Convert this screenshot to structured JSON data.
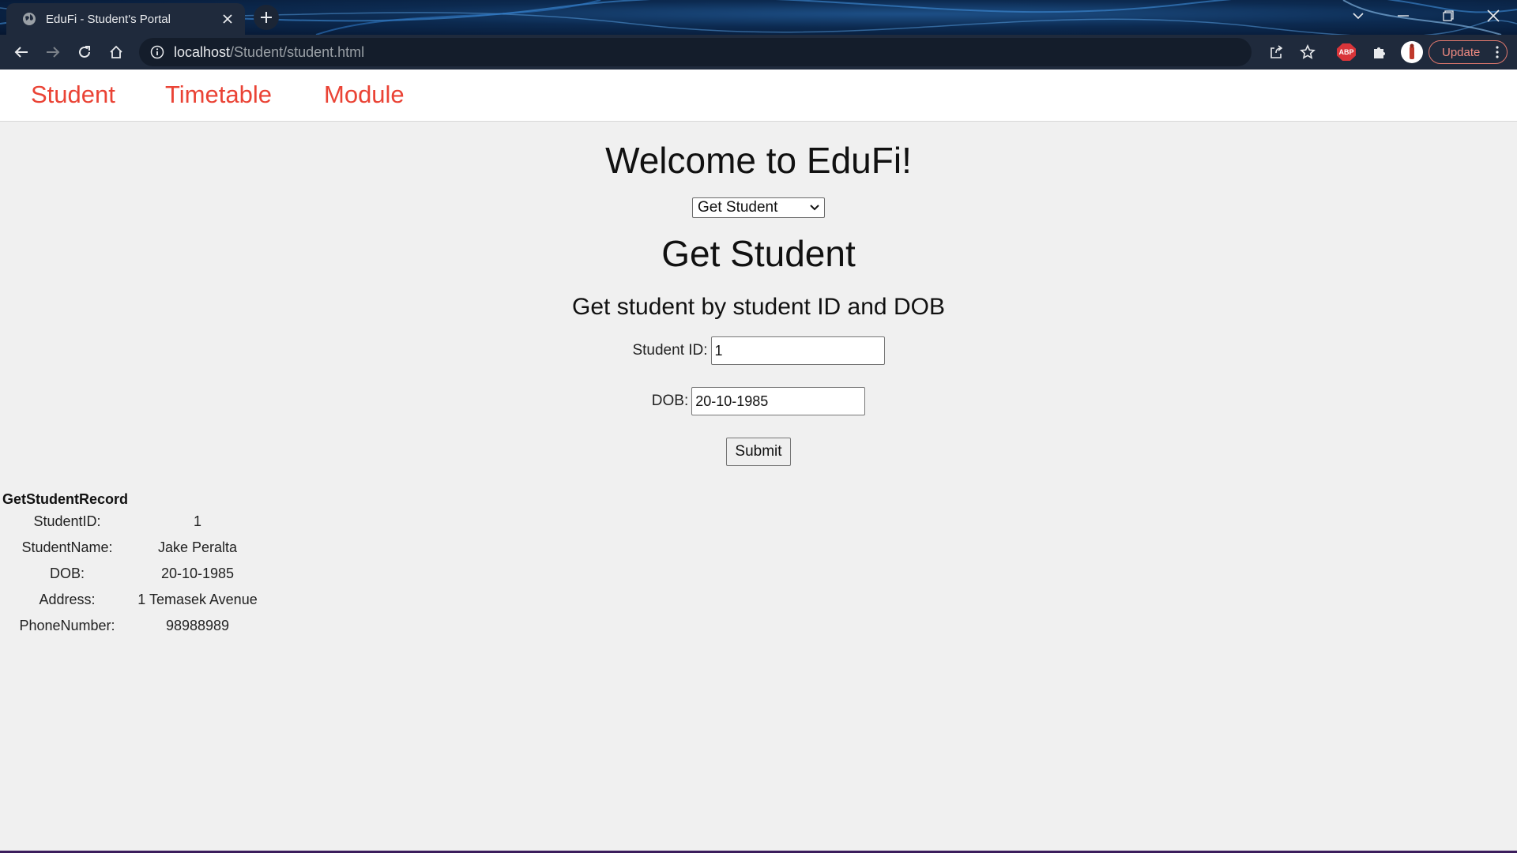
{
  "browser": {
    "tab_title": "EduFi - Student's Portal",
    "url_host": "localhost",
    "url_path": "/Student/student.html",
    "update_label": "Update",
    "abp_label": "ABP",
    "accent_update": "#f28b82"
  },
  "nav": {
    "items": [
      "Student",
      "Timetable",
      "Module"
    ],
    "color": "#ea4335"
  },
  "main": {
    "welcome": "Welcome to EduFi!",
    "select_value": "Get Student",
    "heading": "Get Student",
    "subheading": "Get student by student ID and DOB",
    "student_id_label": "Student ID:",
    "student_id_value": "1",
    "dob_label": "DOB:",
    "dob_value": "20-10-1985",
    "submit_label": "Submit"
  },
  "record": {
    "title": "GetStudentRecord",
    "rows": [
      {
        "label": "StudentID:",
        "value": "1"
      },
      {
        "label": "StudentName:",
        "value": "Jake Peralta"
      },
      {
        "label": "DOB:",
        "value": "20-10-1985"
      },
      {
        "label": "Address:",
        "value": "1 Temasek Avenue"
      },
      {
        "label": "PhoneNumber:",
        "value": "98988989"
      }
    ]
  }
}
